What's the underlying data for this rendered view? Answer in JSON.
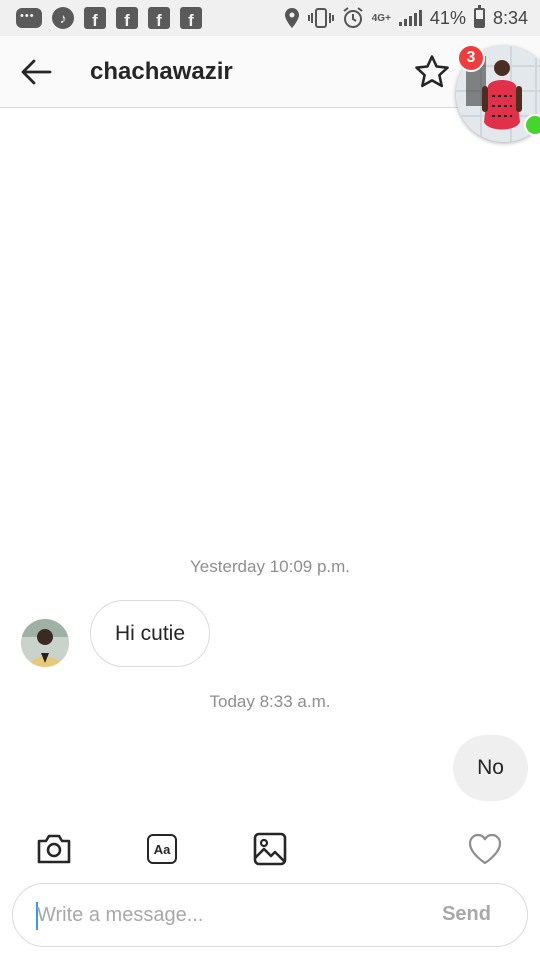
{
  "status_bar": {
    "left_icons": [
      "messages-icon",
      "music-icon",
      "facebook-icon",
      "facebook-icon",
      "facebook-icon",
      "facebook-icon"
    ],
    "facebook_glyph": "f",
    "network_type": "4G+",
    "battery_percent": "41%",
    "battery_level": 0.41,
    "time": "8:34"
  },
  "header": {
    "username": "chachawazir",
    "notification_count": "3"
  },
  "conversation": {
    "messages": [
      {
        "timestamp": "Yesterday 10:09 p.m.",
        "direction": "incoming",
        "text": "Hi cutie"
      },
      {
        "timestamp": "Today 8:33 a.m.",
        "direction": "outgoing",
        "text": "No"
      }
    ]
  },
  "actions": [
    "camera-icon",
    "text-format-icon",
    "gallery-icon",
    "heart-icon"
  ],
  "text_icon_label": "Aa",
  "composer": {
    "placeholder": "Write a message...",
    "value": "",
    "send_label": "Send"
  },
  "colors": {
    "accent_blue": "#3897f0",
    "badge_red": "#f03c3c",
    "online_green": "#44d62c",
    "outgoing_bubble": "#efefef"
  }
}
